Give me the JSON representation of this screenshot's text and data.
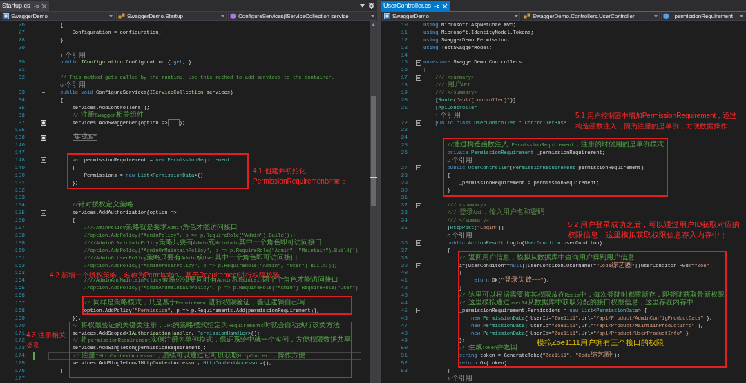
{
  "panes": [
    {
      "tab": {
        "label": "Startup.cs",
        "selected": false
      },
      "nav": [
        {
          "label": "SwaggerDemo",
          "kind": "project"
        },
        {
          "label": "SwaggerDemo.Startup",
          "kind": "class"
        },
        {
          "label": "ConfigureServices(IServiceCollection service",
          "kind": "method"
        }
      ],
      "lines": [
        {
          "kind": "code",
          "n": "26",
          "code": [
            {
              "kind": "p",
              "text": "    {"
            }
          ]
        },
        {
          "kind": "code",
          "n": "27",
          "code": [
            {
              "kind": "p",
              "text": "        Configuration = configuration;"
            }
          ]
        },
        {
          "kind": "code",
          "n": "28",
          "code": [
            {
              "kind": "p",
              "text": "    }"
            }
          ]
        },
        {
          "kind": "code",
          "n": "29"
        },
        {
          "kind": "lens",
          "text": "    1 个引用"
        },
        {
          "kind": "code",
          "n": "30",
          "code": [
            {
              "kind": "kw",
              "text": "    public "
            },
            {
              "kind": "if",
              "text": "IConfiguration"
            },
            {
              "kind": "p",
              "text": " Configuration { "
            },
            {
              "kind": "kw",
              "text": "get"
            },
            {
              "kind": "p",
              "text": "; }"
            }
          ]
        },
        {
          "kind": "code",
          "n": "31"
        },
        {
          "kind": "code",
          "n": "32",
          "code": [
            {
              "kind": "cm",
              "text": "    // This method gets called by the runtime. Use this method to add services to the container."
            }
          ]
        },
        {
          "kind": "lens",
          "text": "    0 个引用"
        },
        {
          "kind": "code",
          "n": "33",
          "expanded": true,
          "code": [
            {
              "kind": "kw",
              "text": "    public void "
            },
            {
              "kind": "p",
              "text": "ConfigureServices("
            },
            {
              "kind": "if",
              "text": "IServiceCollection"
            },
            {
              "kind": "p",
              "text": " services)"
            }
          ]
        },
        {
          "kind": "code",
          "n": "34",
          "code": [
            {
              "kind": "p",
              "text": "    {"
            }
          ]
        },
        {
          "kind": "code",
          "n": "35",
          "code": [
            {
              "kind": "p",
              "text": "        services.AddControllers();"
            }
          ]
        },
        {
          "kind": "code",
          "n": "36",
          "code": [
            {
              "kind": "cm",
              "text": "        // 注册Swagger相关组件"
            }
          ]
        },
        {
          "kind": "code",
          "n": "37",
          "expanded": false,
          "code": [
            {
              "kind": "p",
              "text": "        services.AddSwaggerGen(option =>"
            },
            {
              "kind": "fold",
              "text": "..."
            },
            {
              "kind": "p",
              "text": ");"
            }
          ]
        },
        {
          "kind": "code",
          "n": "105"
        },
        {
          "kind": "code",
          "n": "106",
          "expanded": false,
          "code": [
            {
              "kind": "fold",
              "text": "        集成JWT"
            }
          ]
        },
        {
          "kind": "code",
          "n": "146"
        },
        {
          "kind": "code",
          "n": "147"
        },
        {
          "kind": "code",
          "n": "148",
          "expanded": true,
          "code": [
            {
              "kind": "kw",
              "text": "        var "
            },
            {
              "kind": "p",
              "text": "permissionRequirement = "
            },
            {
              "kind": "kw",
              "text": "new "
            },
            {
              "kind": "ty",
              "text": "PermissionRequirement"
            }
          ]
        },
        {
          "kind": "code",
          "n": "149",
          "code": [
            {
              "kind": "p",
              "text": "        {"
            }
          ]
        },
        {
          "kind": "code",
          "n": "150",
          "code": [
            {
              "kind": "p",
              "text": "            Permissions = "
            },
            {
              "kind": "kw",
              "text": "new "
            },
            {
              "kind": "ty",
              "text": "List"
            },
            {
              "kind": "p",
              "text": "<"
            },
            {
              "kind": "ty",
              "text": "PermissionData"
            },
            {
              "kind": "p",
              "text": ">()"
            }
          ]
        },
        {
          "kind": "code",
          "n": "151",
          "code": [
            {
              "kind": "p",
              "text": "        };"
            }
          ]
        },
        {
          "kind": "code",
          "n": "152"
        },
        {
          "kind": "code",
          "n": "153"
        },
        {
          "kind": "code",
          "n": "154",
          "code": [
            {
              "kind": "cm",
              "text": "        //针对授权定义策略"
            }
          ]
        },
        {
          "kind": "code",
          "n": "155",
          "expanded": true,
          "code": [
            {
              "kind": "p",
              "text": "        services.AddAuthorization(option =>"
            }
          ]
        },
        {
          "kind": "code",
          "n": "156",
          "code": [
            {
              "kind": "p",
              "text": "        {"
            }
          ]
        },
        {
          "kind": "code",
          "n": "157",
          "code": [
            {
              "kind": "cm",
              "text": "            ////AminPolicy策略就是要求Admin角色才能访问接口"
            }
          ]
        },
        {
          "kind": "code",
          "n": "158",
          "code": [
            {
              "kind": "cm",
              "text": "            //option.AddPolicy(\"AdminPolicy\", p => p.RequireRole(\"Admin\").Build());"
            }
          ]
        },
        {
          "kind": "code",
          "n": "159",
          "code": [
            {
              "kind": "cm",
              "text": "            ////AdminOrMaintainPolicy策略只要有Admin或Maintain其中一个角色即可访问接口"
            }
          ]
        },
        {
          "kind": "code",
          "n": "160",
          "code": [
            {
              "kind": "cm",
              "text": "            //option.AddPolicy(\"AdminOrMaintainPolicy\", p => p.RequireRole(\"Admin\", \"Maintain\").Build())"
            }
          ]
        },
        {
          "kind": "code",
          "n": "161",
          "code": [
            {
              "kind": "cm",
              "text": "            ////AdminOrUserPolicy策略只要有Admin或User其中一个角色即可访问接口"
            }
          ]
        },
        {
          "kind": "code",
          "n": "162",
          "code": [
            {
              "kind": "cm",
              "text": "            //option.AddPolicy(\"AdminOrUserPolicy\", p => p.RequireRole(\"Admin\", \"User\").Build());"
            }
          ]
        },
        {
          "kind": "code",
          "n": "163"
        },
        {
          "kind": "code",
          "n": "164",
          "code": [
            {
              "kind": "cm",
              "text": "            ////AdminAndMaintainPolicy策略必须要同时有Admin和Maintain两个个角色才能访问接口"
            }
          ]
        },
        {
          "kind": "code",
          "n": "165",
          "code": [
            {
              "kind": "cm",
              "text": "            //option.AddPolicy(\"AdminAndMaintainPolicy\", p => p.RequireRole(\"Admin\").RequireRole(\"User\")"
            }
          ]
        },
        {
          "kind": "code",
          "n": "166"
        },
        {
          "kind": "code",
          "n": "167",
          "code": [
            {
              "kind": "cm",
              "text": "            // 同样是策略模式，只是基于Requirement进行权限验证，验证逻辑自己写"
            }
          ]
        },
        {
          "kind": "code",
          "n": "168",
          "code": [
            {
              "kind": "p",
              "text": "            option.AddPolicy("
            },
            {
              "kind": "str",
              "text": "\"Permission\""
            },
            {
              "kind": "p",
              "text": ", p => p.Requirements.Add(permissionRequirement));"
            }
          ]
        },
        {
          "kind": "code",
          "n": "169",
          "code": [
            {
              "kind": "p",
              "text": "        });"
            }
          ]
        },
        {
          "kind": "code",
          "n": "170",
          "code": [
            {
              "kind": "cm",
              "text": "        // 将权限验证的关键类注册，Jwt的策略模式指定为Requirements时就会自动执行该类方法"
            }
          ]
        },
        {
          "kind": "code",
          "n": "171",
          "code": [
            {
              "kind": "p",
              "text": "        services.AddScoped<"
            },
            {
              "kind": "if",
              "text": "IAuthorizationHandler"
            },
            {
              "kind": "p",
              "text": ", "
            },
            {
              "kind": "ty",
              "text": "PermissionHandler"
            },
            {
              "kind": "p",
              "text": ">();"
            }
          ]
        },
        {
          "kind": "code",
          "n": "172",
          "code": [
            {
              "kind": "cm",
              "text": "        // 将permissionRequirement实例注册为单例模式，保证系统中就一个实例，方便权限数据共享"
            }
          ]
        },
        {
          "kind": "code",
          "n": "173",
          "code": [
            {
              "kind": "p",
              "text": "        services.AddSingleton(permissionRequirement);"
            }
          ]
        },
        {
          "kind": "code",
          "n": "174",
          "current": true,
          "code": [
            {
              "kind": "cm",
              "text": "        // 注册IHttpContextAccessor，后续可以通过它可以获取HttpContext，操作方便"
            }
          ]
        },
        {
          "kind": "code",
          "n": "175",
          "code": [
            {
              "kind": "p",
              "text": "        services.AddSingleton<"
            },
            {
              "kind": "if",
              "text": "IHttpContextAccessor"
            },
            {
              "kind": "p",
              "text": ", "
            },
            {
              "kind": "ty",
              "text": "HttpContextAccessor"
            },
            {
              "kind": "p",
              "text": ">();"
            }
          ]
        },
        {
          "kind": "code",
          "n": "176",
          "code": [
            {
              "kind": "p",
              "text": "    }"
            }
          ]
        },
        {
          "kind": "code",
          "n": "177"
        }
      ],
      "annotations": [
        {
          "text": "4.1 创建并初始化PermissionRequirement对象；",
          "color": "#ff2a2a"
        },
        {
          "text": "4.2 新增一个授权策略，名称为Permission，基于Requirement进行权限校验",
          "color": "#ff2a2a"
        },
        {
          "text": "4.3 注册相关类型",
          "color": "#ff2a2a"
        }
      ]
    },
    {
      "tab": {
        "label": "UserController.cs",
        "selected": true
      },
      "nav": [
        {
          "label": "SwaggerDemo",
          "kind": "project"
        },
        {
          "label": "SwaggerDemo.Controllers.UserController",
          "kind": "class"
        },
        {
          "label": "_permissionRequirement",
          "kind": "field"
        }
      ],
      "lines": [
        {
          "kind": "code",
          "n": "10",
          "code": [
            {
              "kind": "kw",
              "text": "using "
            },
            {
              "kind": "p",
              "text": "Microsoft.AspNetCore.Mvc;"
            }
          ]
        },
        {
          "kind": "code",
          "n": "11",
          "code": [
            {
              "kind": "kw",
              "text": "using "
            },
            {
              "kind": "p",
              "text": "Microsoft.IdentityModel.Tokens;"
            }
          ]
        },
        {
          "kind": "code",
          "n": "12",
          "code": [
            {
              "kind": "kw",
              "text": "using "
            },
            {
              "kind": "p",
              "text": "SwaggerDemo.Permission;"
            }
          ]
        },
        {
          "kind": "code",
          "n": "13",
          "code": [
            {
              "kind": "kw",
              "text": "using "
            },
            {
              "kind": "p",
              "text": "TestSwaggerModel;"
            }
          ]
        },
        {
          "kind": "code",
          "n": "14"
        },
        {
          "kind": "code",
          "n": "15",
          "expanded": true,
          "code": [
            {
              "kind": "kw",
              "text": "namespace "
            },
            {
              "kind": "p",
              "text": "SwaggerDemo.Controllers"
            }
          ]
        },
        {
          "kind": "code",
          "n": "16",
          "code": [
            {
              "kind": "p",
              "text": "{"
            }
          ]
        },
        {
          "kind": "code",
          "n": "17",
          "expanded": true,
          "code": [
            {
              "kind": "doc",
              "text": "    /// <summary>"
            }
          ]
        },
        {
          "kind": "code",
          "n": "18",
          "code": [
            {
              "kind": "doc",
              "text": "    /// 用户API"
            }
          ]
        },
        {
          "kind": "code",
          "n": "19",
          "code": [
            {
              "kind": "doc",
              "text": "    /// </summary>"
            }
          ]
        },
        {
          "kind": "code",
          "n": "20",
          "code": [
            {
              "kind": "p",
              "text": "    ["
            },
            {
              "kind": "ty",
              "text": "Route"
            },
            {
              "kind": "p",
              "text": "("
            },
            {
              "kind": "str",
              "text": "\"api/[controller]\""
            },
            {
              "kind": "p",
              "text": ")]"
            }
          ]
        },
        {
          "kind": "code",
          "n": "21",
          "code": [
            {
              "kind": "p",
              "text": "    ["
            },
            {
              "kind": "ty",
              "text": "ApiController"
            },
            {
              "kind": "p",
              "text": "]"
            }
          ]
        },
        {
          "kind": "lens",
          "text": "    1 个引用"
        },
        {
          "kind": "code",
          "n": "22",
          "expanded": true,
          "code": [
            {
              "kind": "kw",
              "text": "    public class "
            },
            {
              "kind": "ty",
              "text": "UserController"
            },
            {
              "kind": "p",
              "text": " : "
            },
            {
              "kind": "ty",
              "text": "ControllerBase"
            }
          ]
        },
        {
          "kind": "code",
          "n": "23",
          "code": [
            {
              "kind": "p",
              "text": "    {"
            }
          ]
        },
        {
          "kind": "code",
          "n": "24"
        },
        {
          "kind": "code",
          "n": "25",
          "code": [
            {
              "kind": "cm",
              "text": "        //通过构造函数注入 PermissionRequirement，注册的时候用的是单例模式"
            }
          ]
        },
        {
          "kind": "code",
          "n": "26",
          "code": [
            {
              "kind": "kw",
              "text": "        private "
            },
            {
              "kind": "ty",
              "text": "PermissionRequirement"
            },
            {
              "kind": "p",
              "text": " _permissionRequirement;"
            }
          ]
        },
        {
          "kind": "lens",
          "text": "        0 个引用"
        },
        {
          "kind": "code",
          "n": "27",
          "expanded": true,
          "code": [
            {
              "kind": "kw",
              "text": "        public "
            },
            {
              "kind": "ty",
              "text": "UserController"
            },
            {
              "kind": "p",
              "text": "("
            },
            {
              "kind": "ty",
              "text": "PermissionRequirement"
            },
            {
              "kind": "p",
              "text": " permissionRequirement)"
            }
          ]
        },
        {
          "kind": "code",
          "n": "28",
          "code": [
            {
              "kind": "p",
              "text": "        {"
            }
          ]
        },
        {
          "kind": "code",
          "n": "29",
          "code": [
            {
              "kind": "p",
              "text": "            _permissionRequirement = permissionRequirement;"
            }
          ]
        },
        {
          "kind": "code",
          "n": "30",
          "code": [
            {
              "kind": "p",
              "text": "        }"
            }
          ]
        },
        {
          "kind": "code",
          "n": "31"
        },
        {
          "kind": "code",
          "n": "32",
          "expanded": true,
          "code": [
            {
              "kind": "doc",
              "text": "        /// <summary>"
            }
          ]
        },
        {
          "kind": "code",
          "n": "33",
          "code": [
            {
              "kind": "doc",
              "text": "        /// 登录Api，传入用户名和密码"
            }
          ]
        },
        {
          "kind": "code",
          "n": "34",
          "code": [
            {
              "kind": "doc",
              "text": "        /// </summary>"
            }
          ]
        },
        {
          "kind": "code",
          "n": "35",
          "code": [
            {
              "kind": "p",
              "text": "        ["
            },
            {
              "kind": "ty",
              "text": "HttpPost"
            },
            {
              "kind": "p",
              "text": "("
            },
            {
              "kind": "str",
              "text": "\"Login\""
            },
            {
              "kind": "p",
              "text": ")]"
            }
          ]
        },
        {
          "kind": "lens",
          "text": "        0 个引用"
        },
        {
          "kind": "code",
          "n": "36",
          "expanded": true,
          "code": [
            {
              "kind": "kw",
              "text": "        public "
            },
            {
              "kind": "ty",
              "text": "ActionResult"
            },
            {
              "kind": "p",
              "text": " Login("
            },
            {
              "kind": "ty",
              "text": "UserConditon"
            },
            {
              "kind": "p",
              "text": " userConditon)"
            }
          ]
        },
        {
          "kind": "code",
          "n": "37",
          "code": [
            {
              "kind": "p",
              "text": "        {"
            }
          ]
        },
        {
          "kind": "code",
          "n": "38",
          "code": [
            {
              "kind": "cm",
              "text": "            // 返回用户信息，模拟从数据库中查询用户得到用户信息"
            }
          ]
        },
        {
          "kind": "code",
          "n": "39",
          "expanded": true,
          "code": [
            {
              "kind": "p",
              "text": "            if(userConditon=="
            },
            {
              "kind": "kw",
              "text": "null"
            },
            {
              "kind": "p",
              "text": "||userConditon.UserName!="
            },
            {
              "kind": "str",
              "text": "\"Code综艺圈\""
            },
            {
              "kind": "p",
              "text": "||userConditon.Pwd!="
            },
            {
              "kind": "str",
              "text": "\"Zoe\""
            },
            {
              "kind": "p",
              "text": ")"
            }
          ]
        },
        {
          "kind": "code",
          "n": "40",
          "code": [
            {
              "kind": "p",
              "text": "            {"
            }
          ]
        },
        {
          "kind": "code",
          "n": "41",
          "code": [
            {
              "kind": "kw",
              "text": "                return "
            },
            {
              "kind": "p",
              "text": "Ok("
            },
            {
              "kind": "str",
              "text": "\"登录失败~~~\""
            },
            {
              "kind": "p",
              "text": ");"
            }
          ]
        },
        {
          "kind": "code",
          "n": "42",
          "code": [
            {
              "kind": "p",
              "text": "            }"
            }
          ]
        },
        {
          "kind": "code",
          "n": "43",
          "code": [
            {
              "kind": "cm",
              "text": "            // 这里可以根据需要将其权限放在Redis中，每次登陆时都重新存，即登陆获取最新权限"
            }
          ]
        },
        {
          "kind": "code",
          "n": "44",
          "code": [
            {
              "kind": "cm",
              "text": "            // 这里模拟通过userId从数据库中获取分配的接口权限信息，这里存在内存中"
            }
          ]
        },
        {
          "kind": "code",
          "n": "45",
          "expanded": true,
          "code": [
            {
              "kind": "p",
              "text": "            _permissionRequirement.Permissions = "
            },
            {
              "kind": "kw",
              "text": "new "
            },
            {
              "kind": "ty",
              "text": "List"
            },
            {
              "kind": "p",
              "text": "<"
            },
            {
              "kind": "ty",
              "text": "PermissionData"
            },
            {
              "kind": "p",
              "text": "> {"
            }
          ]
        },
        {
          "kind": "code",
          "n": "46",
          "code": [
            {
              "kind": "kw",
              "text": "                new "
            },
            {
              "kind": "ty",
              "text": "PermissionData"
            },
            {
              "kind": "p",
              "text": "{ UserId="
            },
            {
              "kind": "str",
              "text": "\"Zoe1111\""
            },
            {
              "kind": "p",
              "text": ",Url="
            },
            {
              "kind": "str",
              "text": "\"/api/Product/AdminConfigProductData\""
            },
            {
              "kind": "p",
              "text": " },"
            }
          ]
        },
        {
          "kind": "code",
          "n": "47",
          "code": [
            {
              "kind": "kw",
              "text": "                new "
            },
            {
              "kind": "ty",
              "text": "PermissionData"
            },
            {
              "kind": "p",
              "text": "{ UserId="
            },
            {
              "kind": "str",
              "text": "\"Zoe1111\""
            },
            {
              "kind": "p",
              "text": ",Url="
            },
            {
              "kind": "str",
              "text": "\"/api/Product/MaintainProductInfo\""
            },
            {
              "kind": "p",
              "text": " },"
            }
          ]
        },
        {
          "kind": "code",
          "n": "48",
          "code": [
            {
              "kind": "kw",
              "text": "                new "
            },
            {
              "kind": "ty",
              "text": "PermissionData"
            },
            {
              "kind": "p",
              "text": "{ UserId="
            },
            {
              "kind": "str",
              "text": "\"Zoe1111\""
            },
            {
              "kind": "p",
              "text": ",Url="
            },
            {
              "kind": "str",
              "text": "\"/api/Product/UserProductInfo\""
            },
            {
              "kind": "p",
              "text": " }"
            }
          ]
        },
        {
          "kind": "code",
          "n": "49",
          "code": [
            {
              "kind": "p",
              "text": "            };"
            }
          ]
        },
        {
          "kind": "code",
          "n": "50",
          "code": [
            {
              "kind": "cm",
              "text": "            // 生成Token并返回"
            }
          ]
        },
        {
          "kind": "code",
          "n": "51",
          "code": [
            {
              "kind": "kw",
              "text": "            string "
            },
            {
              "kind": "p",
              "text": "token = GenerateToke("
            },
            {
              "kind": "str",
              "text": "\"Zoe1111\""
            },
            {
              "kind": "p",
              "text": ", "
            },
            {
              "kind": "str",
              "text": "\"Code综艺圈\""
            },
            {
              "kind": "p",
              "text": ");"
            }
          ]
        },
        {
          "kind": "code",
          "n": "52",
          "code": [
            {
              "kind": "kw",
              "text": "            return "
            },
            {
              "kind": "p",
              "text": "Ok(token);"
            }
          ]
        },
        {
          "kind": "code",
          "n": "53",
          "code": [
            {
              "kind": "p",
              "text": "        }"
            }
          ]
        },
        {
          "kind": "lens",
          "text": "        1 个引用"
        }
      ],
      "annotations": [
        {
          "text": "5.1 用户控制器中增加PermissionRequirement，通过构造函数注入，因为注册的是单例，方便数据操作",
          "color": "#ff2a2a"
        },
        {
          "text": "5.2 用户登录成功之后，可以通过用户ID获取对应的权限信息，这里模拟获取权限信息存入内存中；",
          "color": "#ff2a2a"
        },
        {
          "text": "模拟Zoe1111用户拥有三个接口的权限",
          "color": "#e6c200"
        }
      ]
    }
  ]
}
